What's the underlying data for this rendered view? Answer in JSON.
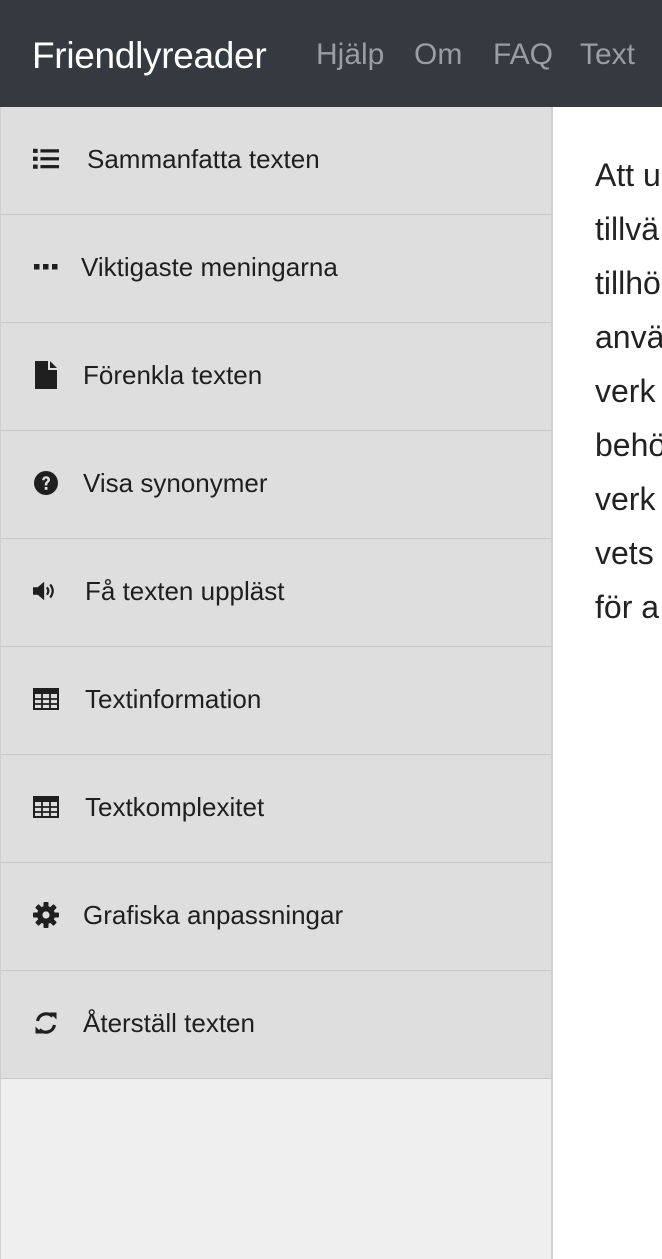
{
  "navbar": {
    "brand": "Friendlyreader",
    "links": [
      "Hjälp",
      "Om",
      "FAQ",
      "Text"
    ]
  },
  "sidebar": {
    "items": [
      {
        "label": "Sammanfatta texten",
        "icon": "list-icon"
      },
      {
        "label": "Viktigaste meningarna",
        "icon": "ellipsis-icon"
      },
      {
        "label": "Förenkla texten",
        "icon": "file-icon"
      },
      {
        "label": "Visa synonymer",
        "icon": "question-circle-icon"
      },
      {
        "label": "Få texten uppläst",
        "icon": "volume-icon"
      },
      {
        "label": "Textinformation",
        "icon": "table-icon"
      },
      {
        "label": "Textkomplexitet",
        "icon": "table-icon"
      },
      {
        "label": "Grafiska anpassningar",
        "icon": "gear-icon"
      },
      {
        "label": "Återställ texten",
        "icon": "refresh-icon"
      }
    ]
  },
  "content": {
    "lines": [
      "Att u",
      "tillvä",
      "tillhö",
      "anvä",
      "verk",
      "behö",
      "verk",
      "vets",
      "för a"
    ]
  },
  "colors": {
    "navbar_bg": "#343a40",
    "nav_link": "#9a9da1",
    "menu_bg": "#dedede",
    "sidebar_bg": "#efefef"
  }
}
